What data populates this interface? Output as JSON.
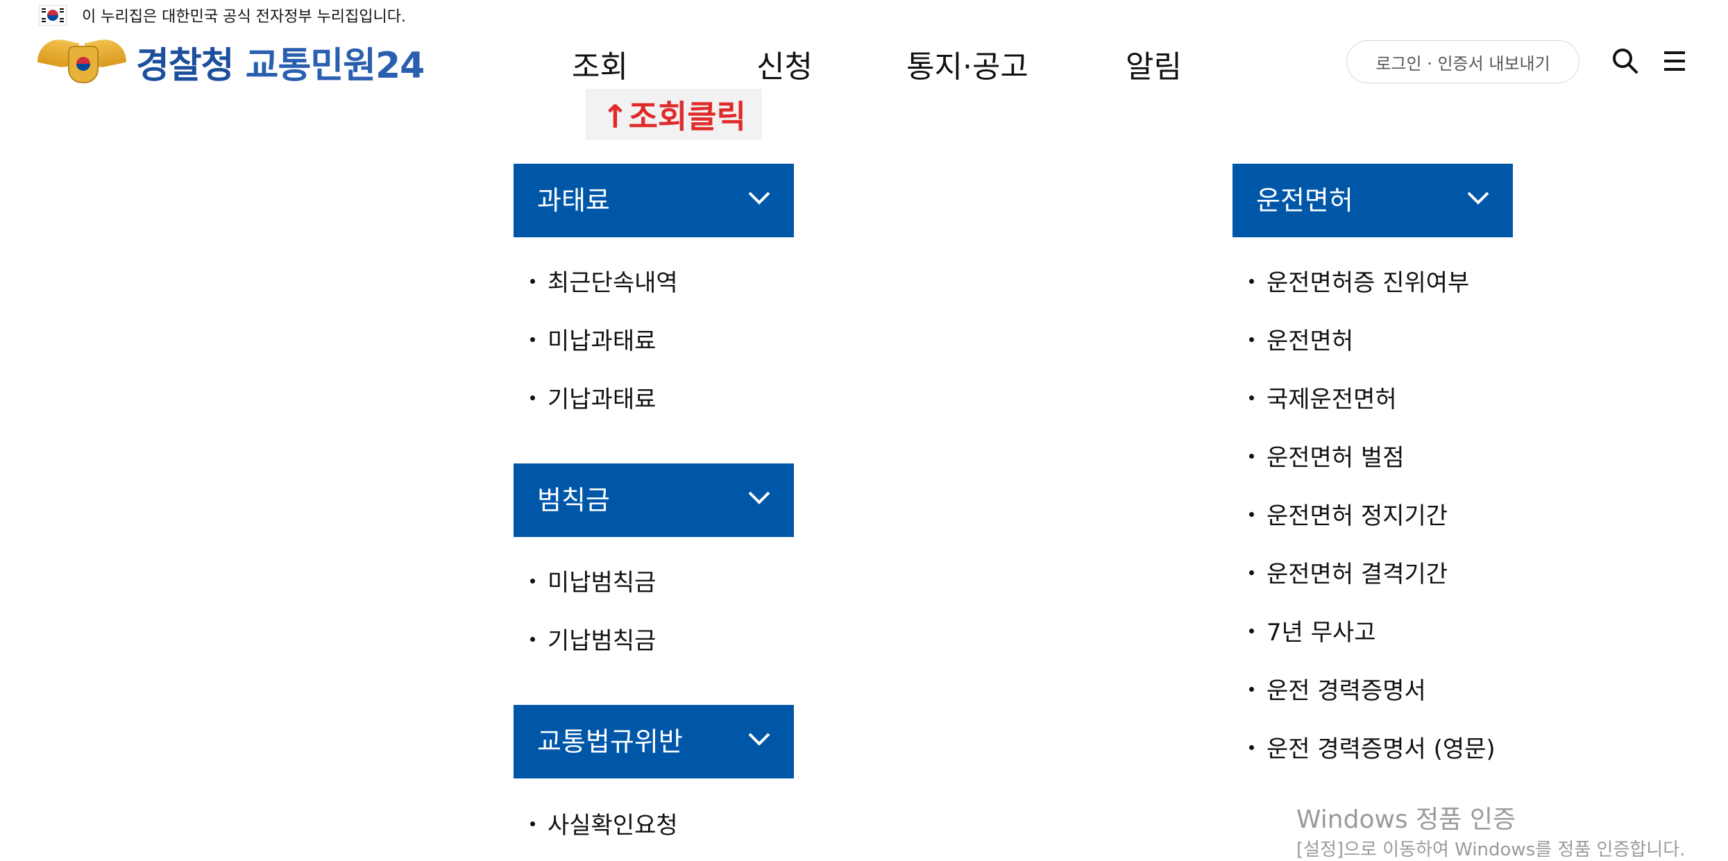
{
  "gov_notice": "이 누리집은 대한민국 공식 전자정부 누리집입니다.",
  "logo": {
    "part1": "경찰청",
    "part2": "교통민원24"
  },
  "nav": [
    {
      "label": "조회"
    },
    {
      "label": "신청"
    },
    {
      "label": "통지·공고"
    },
    {
      "label": "알림"
    }
  ],
  "login_button": "로그인 · 인증서 내보내기",
  "annotation": "↑조회클릭",
  "sections": {
    "fine": {
      "title": "과태료",
      "items": [
        "최근단속내역",
        "미납과태료",
        "기납과태료"
      ]
    },
    "penalty": {
      "title": "범칙금",
      "items": [
        "미납범칙금",
        "기납범칙금"
      ]
    },
    "violation": {
      "title": "교통법규위반",
      "items": [
        "사실확인요청"
      ]
    },
    "license": {
      "title": "운전면허",
      "items": [
        "운전면허증 진위여부",
        "운전면허",
        "국제운전면허",
        "운전면허 벌점",
        "운전면허 정지기간",
        "운전면허 결격기간",
        "7년 무사고",
        "운전 경력증명서",
        "운전 경력증명서 (영문)"
      ]
    }
  },
  "watermark": {
    "line1": "Windows 정품 인증",
    "line2": "[설정]으로 이동하여 Windows를 정품 인증합니다."
  },
  "colors": {
    "section_header": "#0057a8",
    "annotation_text": "#e02a2a",
    "brand": "#1c4f9c"
  }
}
